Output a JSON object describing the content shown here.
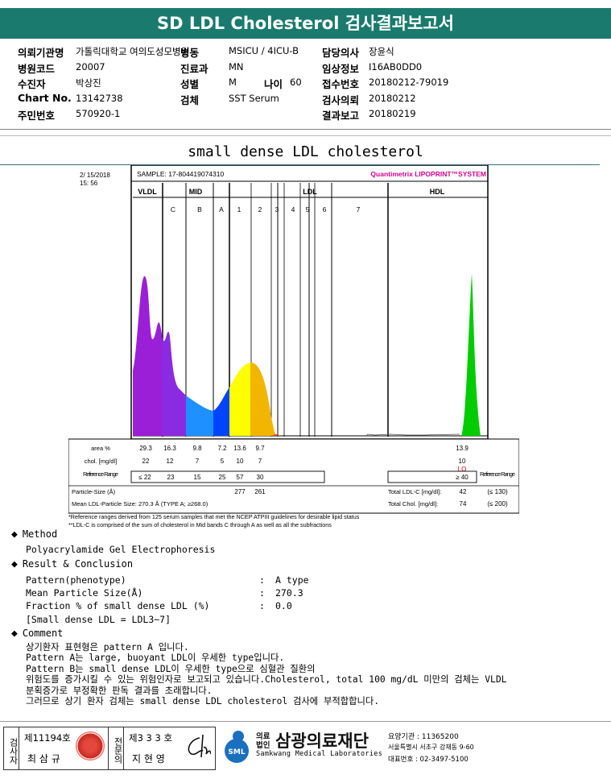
{
  "title": "SD LDL Cholesterol 검사결과보고서",
  "info": {
    "rows": [
      [
        {
          "l": "의뢰기관명",
          "v": "가톨릭대학교 여의도성모병원"
        },
        {
          "l": "병동",
          "v": "MSICU / 4ICU-B"
        },
        {
          "l": "담당의사",
          "v": "장윤식"
        }
      ],
      [
        {
          "l": "병원코드",
          "v": "20007"
        },
        {
          "l": "진료과",
          "v": "MN"
        },
        {
          "l": "임상정보",
          "v": "I16AB0DD0"
        }
      ],
      [
        {
          "l": "수진자",
          "v": "박상진"
        },
        {
          "l": "성별",
          "v": "M"
        },
        {
          "l": "접수번호",
          "v": "20180212-79019"
        }
      ],
      [
        {
          "l": "Chart No.",
          "v": "13142738"
        },
        {
          "l": "검체",
          "v": "SST Serum"
        },
        {
          "l": "검사의뢰",
          "v": "20180212"
        }
      ],
      [
        {
          "l": "주민번호",
          "v": "570920-1"
        },
        null,
        {
          "l": "결과보고",
          "v": "20180219"
        }
      ]
    ],
    "age_label": "나이",
    "age_value": "60"
  },
  "section_title": "small dense LDL cholesterol",
  "chart_data": {
    "type": "area",
    "date": "2/ 15/2018",
    "time": "15: 56",
    "sample": "SAMPLE:   17-804419074310",
    "brand": "Quantimetrix LIPOPRINT™SYSTEM",
    "bands": [
      "VLDL",
      "MID",
      "LDL",
      "HDL"
    ],
    "subbands": [
      "C",
      "B",
      "A",
      "1",
      "2",
      "3",
      "4",
      "5",
      "6",
      "7"
    ],
    "table": {
      "area_label": "area %",
      "area": [
        "29.3",
        "16.3",
        "9.8",
        "7.2",
        "13.6",
        "9.7",
        "13.9"
      ],
      "chol_label": "chol. [mg/dl]",
      "chol": [
        "22",
        "12",
        "7",
        "5",
        "10",
        "7",
        "10"
      ],
      "hdl_flag": "LO",
      "ref_label": "Reference Range",
      "ref": [
        "≤ 22",
        "23",
        "15",
        "25",
        "57",
        "30"
      ],
      "ref_hdl": "≥ 40",
      "ref_right": "Reference Range",
      "particle_label": "Particle-Size (Å)",
      "particle": [
        "277",
        "261"
      ],
      "mean_label": "Mean LDL-Particle Size:  270.3 Å  (TYPE A; ≥268.0)",
      "total_ldl_label": "Total LDL-C [mg/dl]:",
      "total_ldl": "42",
      "total_ldl_ref": "(≤ 130)",
      "total_chol_label": "Total Chol. [mg/dl]:",
      "total_chol": "74",
      "total_chol_ref": "(≤ 200)"
    },
    "notes": [
      "*Reference ranges derived from 125 serum samples that met the NCEP ATPIII guidelines for desirable lipid status",
      "**LDL-C is comprised of the sum of cholesterol in Mid bands C through A as well as all the subfractions"
    ]
  },
  "method": {
    "heading": "Method",
    "text": "Polyacrylamide Gel Electrophoresis"
  },
  "result": {
    "heading": "Result & Conclusion",
    "lines": [
      {
        "k": "Pattern(phenotype)",
        "v": "A type"
      },
      {
        "k": "Mean Particle Size(Å)",
        "v": "270.3"
      },
      {
        "k": "Fraction % of small dense LDL (%)",
        "v": "0.0"
      }
    ],
    "note": "[Small dense LDL = LDL3~7]"
  },
  "comment": {
    "heading": "Comment",
    "lines": [
      "상기환자 표현형은 pattern A 입니다.",
      "Pattern A는 large, buoyant LDL이 우세한 type입니다.",
      "Pattern B는 small dense LDL이 우세한 type으로 심혈관 질환의",
      "위험도를 증가시킬 수 있는 위험인자로 보고되고 있습니다.Cholesterol, total 100 mg/dL 미만의 검체는 VLDL",
      "분획증가로 부정확한 판독 결과를 초래합니다.",
      "그러므로 상기 환자 검체는 small dense LDL cholesterol 검사에 부적합합니다."
    ]
  },
  "footer": {
    "inspector_label": "검사자",
    "inspector_no": "제11194호",
    "inspector_name": "최 삼 규",
    "specialist_label": "전문의",
    "specialist_no": "제3 3 3 호",
    "specialist_name": "지 현 영",
    "org_prefix": "의료법인",
    "org_name": "삼광의료재단",
    "org_en": "Samkwang Medical Laboratories",
    "org_code": "요양기관 : 11365200",
    "org_addr": "서울특별시 서초구 강재동 9-60",
    "org_tel": "대표번호 : 02-3497-5100",
    "logo": "SML"
  },
  "colors": {
    "header": "#1a7a6e",
    "vldl": "#9b1fd6",
    "midC": "#8a2be2",
    "midB": "#1e90ff",
    "midA": "#0044ff",
    "ldl1": "#ffff00",
    "ldl2": "#f2b600",
    "hdl": "#00cc00"
  }
}
